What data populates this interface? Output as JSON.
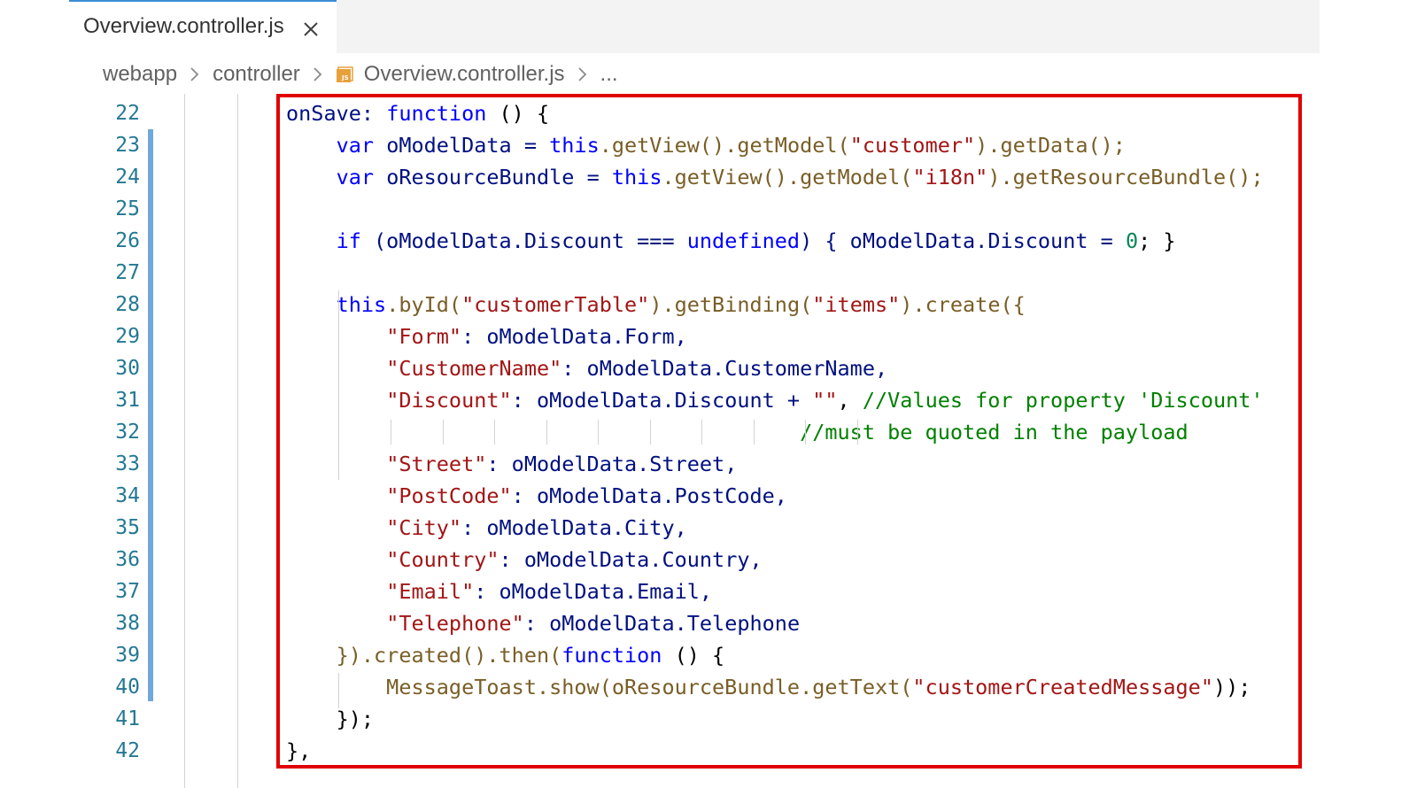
{
  "tab": {
    "label": "Overview.controller.js",
    "close_icon": "close-icon"
  },
  "breadcrumb": {
    "items": [
      "webapp",
      "controller",
      "Overview.controller.js",
      "..."
    ],
    "file_icon": "js-file-icon"
  },
  "highlight_color": "#e00000",
  "editor": {
    "lines": [
      {
        "n": "22",
        "tokens": [
          [
            "onSave: ",
            "id"
          ],
          [
            "function",
            "kw"
          ],
          [
            " () {",
            "pl"
          ]
        ]
      },
      {
        "n": "23",
        "tokens": [
          [
            "    ",
            "pl"
          ],
          [
            "var",
            "kw"
          ],
          [
            " oModelData = ",
            "id"
          ],
          [
            "this",
            "kw"
          ],
          [
            ".getView().getModel(",
            "fn"
          ],
          [
            "\"customer\"",
            "str"
          ],
          [
            ").getData();",
            "fn"
          ]
        ]
      },
      {
        "n": "24",
        "tokens": [
          [
            "    ",
            "pl"
          ],
          [
            "var",
            "kw"
          ],
          [
            " oResourceBundle = ",
            "id"
          ],
          [
            "this",
            "kw"
          ],
          [
            ".getView().getModel(",
            "fn"
          ],
          [
            "\"i18n\"",
            "str"
          ],
          [
            ").getResourceBundle();",
            "fn"
          ]
        ]
      },
      {
        "n": "25",
        "tokens": []
      },
      {
        "n": "26",
        "tokens": [
          [
            "    ",
            "pl"
          ],
          [
            "if",
            "kw"
          ],
          [
            " (oModelData.Discount === ",
            "id"
          ],
          [
            "undefined",
            "kw"
          ],
          [
            ") { oModelData.Discount = ",
            "id"
          ],
          [
            "0",
            "num"
          ],
          [
            "; }",
            "pl"
          ]
        ]
      },
      {
        "n": "27",
        "tokens": []
      },
      {
        "n": "28",
        "tokens": [
          [
            "    ",
            "pl"
          ],
          [
            "this",
            "kw"
          ],
          [
            ".byId(",
            "fn"
          ],
          [
            "\"customerTable\"",
            "str"
          ],
          [
            ").getBinding(",
            "fn"
          ],
          [
            "\"items\"",
            "str"
          ],
          [
            ").create({",
            "fn"
          ]
        ]
      },
      {
        "n": "29",
        "tokens": [
          [
            "        ",
            "pl"
          ],
          [
            "\"Form\"",
            "str"
          ],
          [
            ": oModelData.Form,",
            "id"
          ]
        ]
      },
      {
        "n": "30",
        "tokens": [
          [
            "        ",
            "pl"
          ],
          [
            "\"CustomerName\"",
            "str"
          ],
          [
            ": oModelData.CustomerName,",
            "id"
          ]
        ]
      },
      {
        "n": "31",
        "tokens": [
          [
            "        ",
            "pl"
          ],
          [
            "\"Discount\"",
            "str"
          ],
          [
            ": oModelData.Discount + ",
            "id"
          ],
          [
            "\"\"",
            "str"
          ],
          [
            ", ",
            "pl"
          ],
          [
            "//Values for property 'Discount'",
            "com"
          ]
        ]
      },
      {
        "n": "32",
        "tokens": [
          [
            "                                         ",
            "pl"
          ],
          [
            "//must be quoted in the payload",
            "com"
          ]
        ]
      },
      {
        "n": "33",
        "tokens": [
          [
            "        ",
            "pl"
          ],
          [
            "\"Street\"",
            "str"
          ],
          [
            ": oModelData.Street,",
            "id"
          ]
        ]
      },
      {
        "n": "34",
        "tokens": [
          [
            "        ",
            "pl"
          ],
          [
            "\"PostCode\"",
            "str"
          ],
          [
            ": oModelData.PostCode,",
            "id"
          ]
        ]
      },
      {
        "n": "35",
        "tokens": [
          [
            "        ",
            "pl"
          ],
          [
            "\"City\"",
            "str"
          ],
          [
            ": oModelData.City,",
            "id"
          ]
        ]
      },
      {
        "n": "36",
        "tokens": [
          [
            "        ",
            "pl"
          ],
          [
            "\"Country\"",
            "str"
          ],
          [
            ": oModelData.Country,",
            "id"
          ]
        ]
      },
      {
        "n": "37",
        "tokens": [
          [
            "        ",
            "pl"
          ],
          [
            "\"Email\"",
            "str"
          ],
          [
            ": oModelData.Email,",
            "id"
          ]
        ]
      },
      {
        "n": "38",
        "tokens": [
          [
            "        ",
            "pl"
          ],
          [
            "\"Telephone\"",
            "str"
          ],
          [
            ": oModelData.Telephone",
            "id"
          ]
        ]
      },
      {
        "n": "39",
        "tokens": [
          [
            "    }).created().then(",
            "fn"
          ],
          [
            "function",
            "kw"
          ],
          [
            " () {",
            "pl"
          ]
        ]
      },
      {
        "n": "40",
        "tokens": [
          [
            "        MessageToast.show(oResourceBundle.getText(",
            "fn"
          ],
          [
            "\"customerCreatedMessage\"",
            "str"
          ],
          [
            "));",
            "pl"
          ]
        ]
      },
      {
        "n": "41",
        "tokens": [
          [
            "    });",
            "pl"
          ]
        ]
      },
      {
        "n": "42",
        "tokens": [
          [
            "},",
            "pl"
          ]
        ]
      }
    ]
  }
}
